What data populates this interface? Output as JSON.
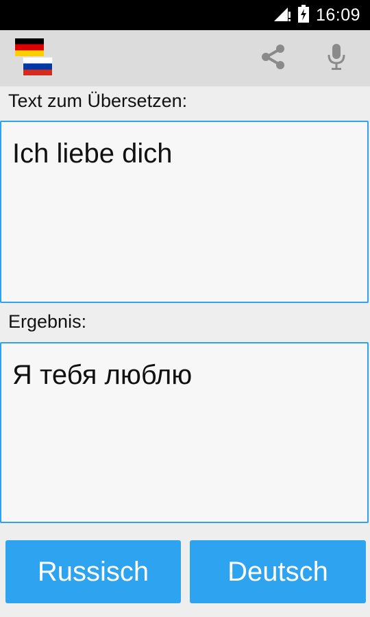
{
  "status_bar": {
    "time": "16:09",
    "icons": [
      "wifi-signal-icon",
      "battery-charging-icon"
    ]
  },
  "toolbar": {
    "source_flag": "germany-flag-icon",
    "target_flag": "russia-flag-icon",
    "actions": [
      "share-icon",
      "microphone-icon"
    ]
  },
  "input": {
    "label": "Text zum Übersetzen:",
    "value": "Ich liebe dich"
  },
  "result": {
    "label": "Ergebnis:",
    "value": "Я тебя люблю"
  },
  "buttons": {
    "left_label": "Russisch",
    "right_label": "Deutsch"
  },
  "colors": {
    "accent": "#2ea3ef",
    "app_bar": "#dcdcdc",
    "background": "#eeeeee",
    "status_bar": "#000000",
    "text_area_bg": "#f7f7f7"
  }
}
